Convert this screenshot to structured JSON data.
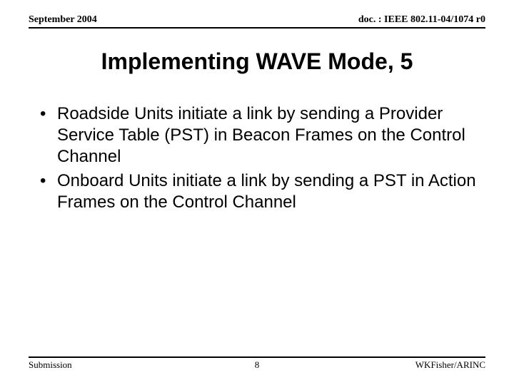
{
  "header": {
    "left": "September 2004",
    "right": "doc. : IEEE 802.11-04/1074 r0"
  },
  "title": "Implementing WAVE Mode, 5",
  "bullets": [
    "Roadside Units initiate a link by sending a Provider Service Table (PST) in Beacon Frames on the Control Channel",
    "Onboard Units initiate a link by sending a PST in Action Frames on the Control Channel"
  ],
  "footer": {
    "left": "Submission",
    "center": "8",
    "right": "WKFisher/ARINC"
  }
}
